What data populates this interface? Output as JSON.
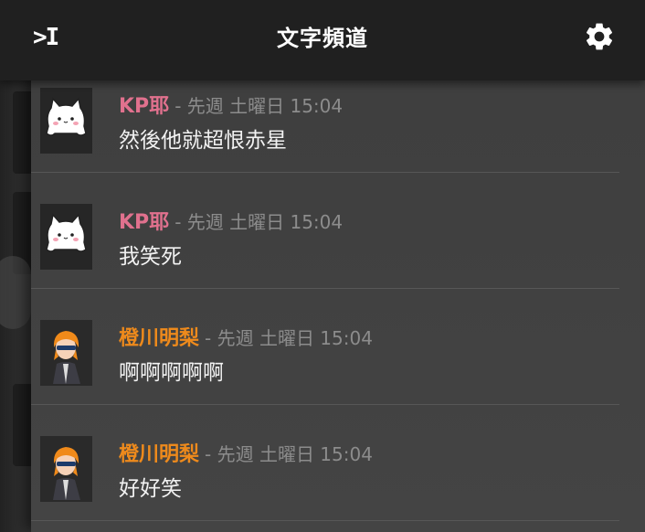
{
  "header": {
    "title": "文字頻道",
    "collapse_glyph": ">I"
  },
  "messages": [
    {
      "author": "KP耶",
      "meta": "- 先週 土曜日 15:04",
      "text": "然後他就超恨赤星",
      "color": "#e1718e"
    },
    {
      "author": "KP耶",
      "meta": "- 先週 土曜日 15:04",
      "text": "我笑死",
      "color": "#e1718e"
    },
    {
      "author": "橙川明梨",
      "meta": "- 先週 土曜日 15:04",
      "text": "啊啊啊啊啊",
      "color": "#ee8a1c"
    },
    {
      "author": "橙川明梨",
      "meta": "- 先週 土曜日 15:04",
      "text": "好好笑",
      "color": "#ee8a1c"
    }
  ]
}
